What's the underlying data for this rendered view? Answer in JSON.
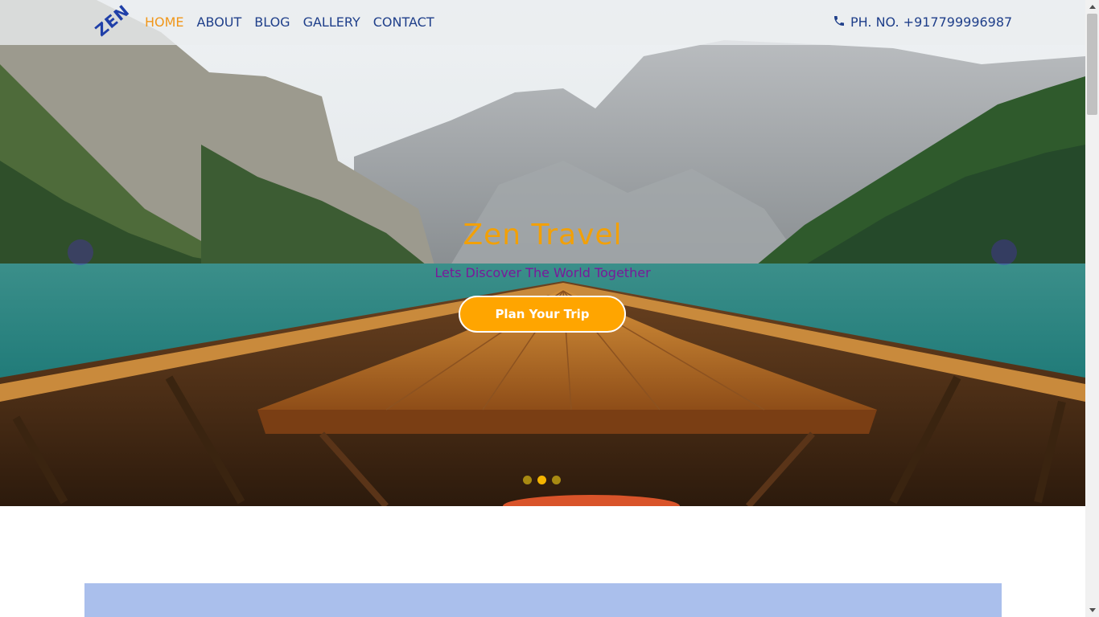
{
  "brand": {
    "logo_text": "ZEN"
  },
  "nav": {
    "links": [
      {
        "label": "HOME",
        "active": true
      },
      {
        "label": "ABOUT",
        "active": false
      },
      {
        "label": "BLOG",
        "active": false
      },
      {
        "label": "GALLERY",
        "active": false
      },
      {
        "label": "CONTACT",
        "active": false
      }
    ],
    "phone": "PH. NO. +917799996987",
    "phone_icon": "phone-icon"
  },
  "hero": {
    "title": "Zen Travel",
    "subtitle": "Lets Discover The World Together",
    "cta_label": "Plan Your Trip",
    "slide_count": 3,
    "active_slide": 2,
    "prev_icon": "prev-arrow-icon",
    "next_icon": "next-arrow-icon"
  },
  "colors": {
    "accent": "#ffa500",
    "nav_text": "#1f3f8a",
    "nav_active": "#f0971a",
    "title": "#f2a007",
    "subtitle": "#7a1a9a",
    "content_block": "#aabfec"
  }
}
